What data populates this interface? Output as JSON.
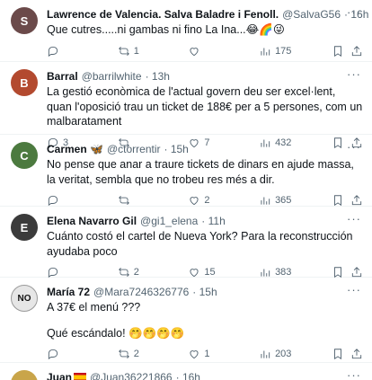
{
  "tweets": [
    {
      "avatar_letter": "S",
      "avatar_color": "#6b4a4a",
      "name": "Lawrence de Valencia. Salva Baladre i Fenoll.",
      "handle": "@SalvaG56",
      "time": "· 16h",
      "text": "Que cutres.....ni gambas ni fino La Ina...😂🌈😜",
      "replies": "",
      "retweets": "1",
      "likes": "",
      "views": "175"
    },
    {
      "avatar_letter": "B",
      "avatar_color": "#b34a2f",
      "name": "Barral",
      "handle": "@barrilwhite",
      "time": "· 13h",
      "text": "La gestió econòmica de l'actual govern deu ser excel·lent, quan l'oposició trau un ticket de 188€ per a 5 persones, com un malbaratament",
      "replies": "3",
      "retweets": "",
      "likes": "7",
      "views": "432"
    },
    {
      "avatar_letter": "C",
      "avatar_color": "#4c7a3f",
      "name": "Carmen 🦋",
      "handle": "@ctorrentir",
      "time": "· 15h",
      "text": "No pense que anar a traure tickets de dinars en ajude massa, la veritat, sembla que no trobeu res més a dir.",
      "replies": "",
      "retweets": "",
      "likes": "2",
      "views": "365"
    },
    {
      "avatar_letter": "E",
      "avatar_color": "#3b3b3b",
      "name": "Elena Navarro Gil",
      "handle": "@gi1_elena",
      "time": "· 11h",
      "text": "Cuánto costó el cartel de Nueva York? Para la reconstrucción ayudaba poco",
      "replies": "",
      "retweets": "2",
      "likes": "15",
      "views": "383"
    },
    {
      "avatar_letter": "NO",
      "avatar_color": "#e6e6e6",
      "name": "María 72",
      "handle": "@Mara7246326776",
      "time": "· 15h",
      "text_lines": [
        "A 37€ el menú ???",
        "",
        "Qué escándalo! 🤭🤭🤭🤭"
      ],
      "replies": "",
      "retweets": "2",
      "likes": "1",
      "views": "203"
    },
    {
      "avatar_letter": "J",
      "avatar_color": "#c9a54a",
      "name": "Juan",
      "handle": "@Juan36221866",
      "time": "· 16h"
    }
  ],
  "icons": {
    "reply": "reply-icon",
    "retweet": "retweet-icon",
    "like": "like-icon",
    "views": "views-icon",
    "bookmark": "bookmark-icon",
    "share": "share-icon",
    "more": "more-icon"
  },
  "more_glyph": "···"
}
